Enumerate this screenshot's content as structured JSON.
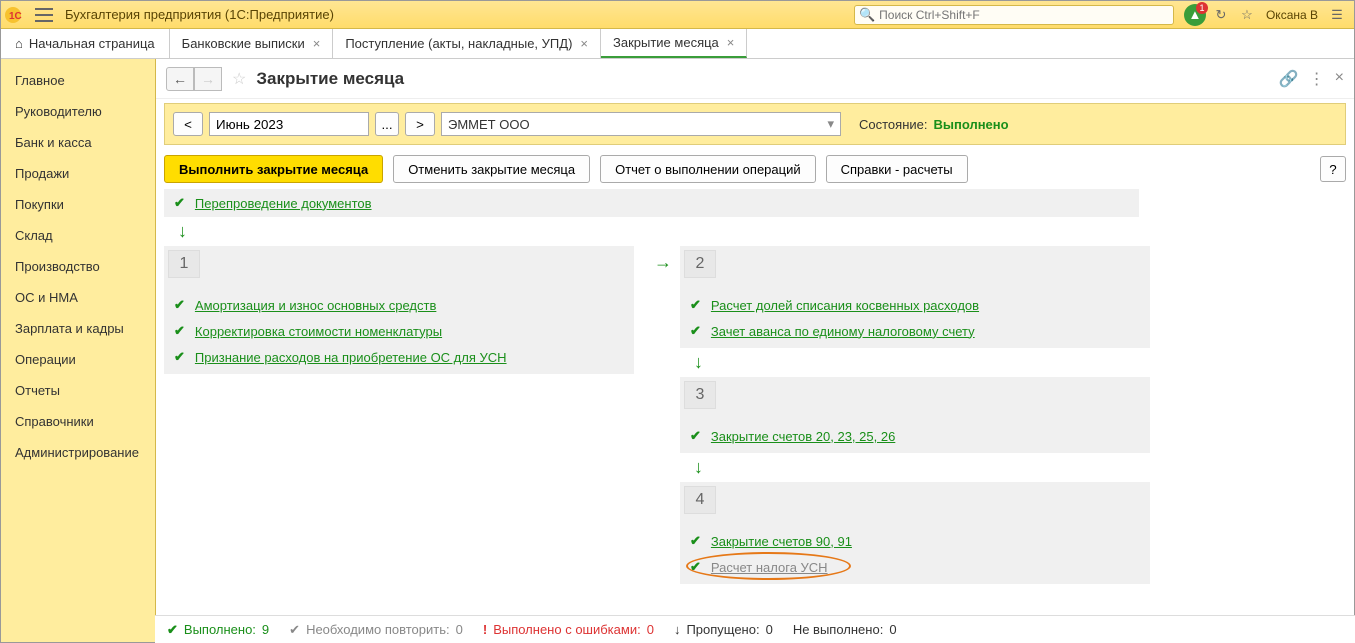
{
  "titlebar": {
    "app_title": "Бухгалтерия предприятия  (1С:Предприятие)",
    "search_placeholder": "Поиск Ctrl+Shift+F",
    "bell_badge": "1",
    "user": "Оксана В"
  },
  "tabs": [
    {
      "label": "Начальная страница",
      "home": true
    },
    {
      "label": "Банковские выписки",
      "closable": true
    },
    {
      "label": "Поступление (акты, накладные, УПД)",
      "closable": true
    },
    {
      "label": "Закрытие месяца",
      "closable": true,
      "active": true
    }
  ],
  "sidebar": {
    "items": [
      "Главное",
      "Руководителю",
      "Банк и касса",
      "Продажи",
      "Покупки",
      "Склад",
      "Производство",
      "ОС и НМА",
      "Зарплата и кадры",
      "Операции",
      "Отчеты",
      "Справочники",
      "Администрирование"
    ]
  },
  "page": {
    "title": "Закрытие месяца",
    "period": "Июнь 2023",
    "org": "ЭММЕТ ООО",
    "status_label": "Состояние:",
    "status_value": "Выполнено"
  },
  "buttons": {
    "execute": "Выполнить закрытие месяца",
    "cancel": "Отменить закрытие месяца",
    "report": "Отчет о выполнении операций",
    "refs": "Справки - расчеты",
    "help": "?"
  },
  "ops": {
    "top": "Перепроведение документов",
    "stage1": [
      "Амортизация и износ основных средств",
      "Корректировка стоимости номенклатуры",
      "Признание расходов на приобретение ОС для УСН"
    ],
    "stage2": [
      "Расчет долей списания косвенных расходов",
      "Зачет аванса по единому налоговому счету"
    ],
    "stage3": [
      "Закрытие счетов 20, 23, 25, 26"
    ],
    "stage4": [
      "Закрытие счетов 90, 91",
      "Расчет налога УСН"
    ]
  },
  "status": {
    "done_label": "Выполнено:",
    "done_count": "9",
    "repeat_label": "Необходимо повторить:",
    "repeat_count": "0",
    "errors_label": "Выполнено с ошибками:",
    "errors_count": "0",
    "skipped_label": "Пропущено:",
    "skipped_count": "0",
    "notdone_label": "Не выполнено:",
    "notdone_count": "0"
  }
}
